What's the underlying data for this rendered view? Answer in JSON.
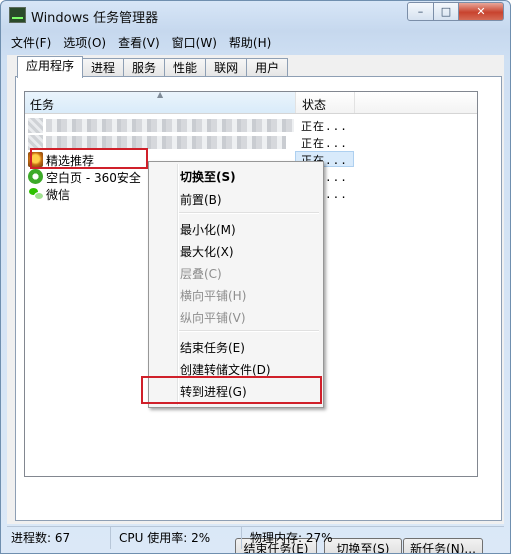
{
  "window": {
    "title": "Windows 任务管理器",
    "controls": {
      "minimize": "–",
      "maximize": "□",
      "close": "✕"
    }
  },
  "menubar": {
    "items": [
      "文件(F)",
      "选项(O)",
      "查看(V)",
      "窗口(W)",
      "帮助(H)"
    ]
  },
  "tabs": {
    "items": [
      "应用程序",
      "进程",
      "服务",
      "性能",
      "联网",
      "用户"
    ],
    "active": "应用程序"
  },
  "task_list": {
    "columns": {
      "task": "任务",
      "status": "状态"
    },
    "rows": [
      {
        "name": "",
        "status": "正在...",
        "icon": "blurred-icon",
        "blurred": true
      },
      {
        "name": "",
        "status": "正在...",
        "icon": "blurred-icon",
        "blurred": true
      },
      {
        "name": "精选推荐",
        "status": "正在...",
        "icon": "featured-app-icon",
        "selected": true
      },
      {
        "name": "空白页 - 360安全",
        "status": "正在...",
        "icon": "browser-360-icon"
      },
      {
        "name": "微信",
        "status": "正在...",
        "icon": "wechat-icon"
      }
    ]
  },
  "context_menu": {
    "items": [
      "切换至(S)",
      "前置(B)",
      "最小化(M)",
      "最大化(X)",
      "层叠(C)",
      "横向平铺(H)",
      "纵向平铺(V)",
      "结束任务(E)",
      "创建转储文件(D)",
      "转到进程(G)"
    ],
    "disabled": [
      "层叠(C)",
      "横向平铺(H)",
      "纵向平铺(V)"
    ],
    "default": "切换至(S)",
    "highlighted": "转到进程(G)"
  },
  "buttons": {
    "end_task": "结束任务(E)",
    "switch_to": "切换至(S)",
    "new_task": "新任务(N)..."
  },
  "statusbar": {
    "processes": "进程数: 67",
    "cpu": "CPU 使用率: 2%",
    "memory": "物理内存: 27%"
  },
  "colors": {
    "highlight_box": "#d0202a",
    "selection": "#d8eafb"
  }
}
